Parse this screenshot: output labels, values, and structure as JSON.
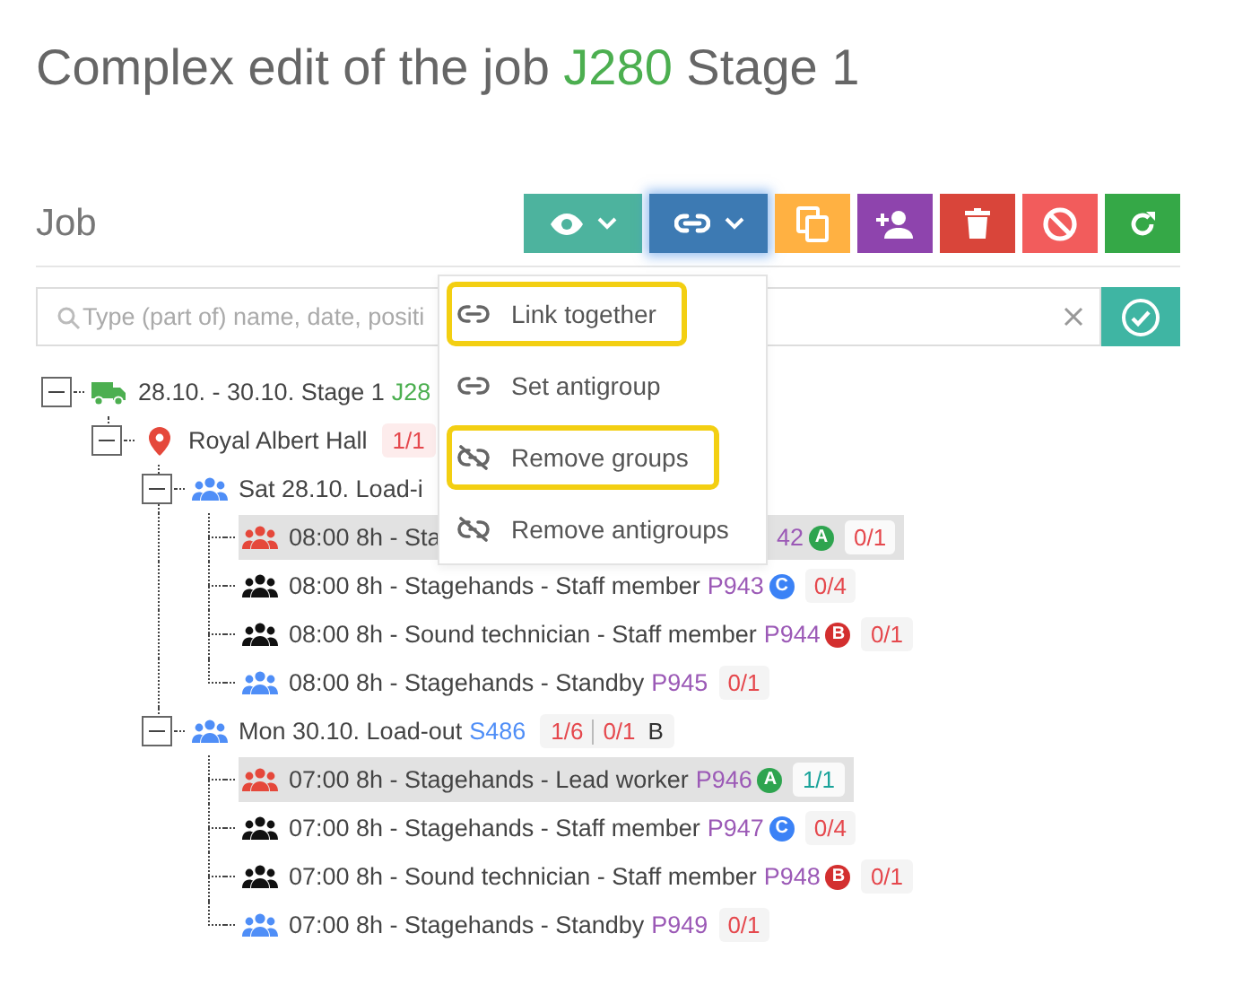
{
  "title": {
    "text": "Complex edit of the job",
    "code": "J280",
    "suffix": "Stage 1"
  },
  "section": {
    "label": "Job"
  },
  "toolbar": [
    {
      "kind": "view",
      "dropdown": true,
      "selected": false
    },
    {
      "kind": "link",
      "dropdown": true,
      "selected": true
    },
    {
      "kind": "copy",
      "dropdown": false,
      "selected": false
    },
    {
      "kind": "add-person",
      "dropdown": false,
      "selected": false
    },
    {
      "kind": "delete",
      "dropdown": false,
      "selected": false
    },
    {
      "kind": "cancel",
      "dropdown": false,
      "selected": false
    },
    {
      "kind": "refresh",
      "dropdown": false,
      "selected": false
    }
  ],
  "search": {
    "placeholder": "Type (part of) name, date, positi"
  },
  "menu": {
    "items": [
      {
        "kind": "link",
        "label": "Link together",
        "highlighted": true
      },
      {
        "kind": "link",
        "label": "Set antigroup",
        "highlighted": false
      },
      {
        "kind": "unlink",
        "label": "Remove groups",
        "highlighted": true
      },
      {
        "kind": "unlink",
        "label": "Remove antigroups",
        "highlighted": false
      }
    ]
  },
  "tree": [
    {
      "kind": "job",
      "expanded": true,
      "text": "28.10. - 30.10. Stage 1",
      "code": "J28",
      "children": [
        {
          "kind": "venue",
          "expanded": true,
          "text": "Royal Albert Hall",
          "counts": [
            {
              "text": "1/1",
              "color": "#e5484d"
            }
          ],
          "children": [
            {
              "kind": "day",
              "expanded": true,
              "text": "Sat 28.10. Load-i",
              "children": [
                {
                  "kind": "shift",
                  "color": "#e5483b",
                  "selected": true,
                  "covered": true,
                  "text": "08:00 8h - Sta",
                  "code": "42",
                  "tag": {
                    "letter": "A",
                    "color": "#2ea44f"
                  },
                  "count": {
                    "text": "0/1",
                    "color": "#e5484d"
                  }
                },
                {
                  "kind": "shift",
                  "color": "#111111",
                  "selected": false,
                  "covered": false,
                  "text": "08:00 8h - Stagehands - Staff member",
                  "code": "P943",
                  "tag": {
                    "letter": "C",
                    "color": "#3b82f6"
                  },
                  "count": {
                    "text": "0/4",
                    "color": "#e5484d"
                  }
                },
                {
                  "kind": "shift",
                  "color": "#111111",
                  "selected": false,
                  "covered": false,
                  "text": "08:00 8h - Sound technician - Staff member",
                  "code": "P944",
                  "tag": {
                    "letter": "B",
                    "color": "#d32f2f"
                  },
                  "count": {
                    "text": "0/1",
                    "color": "#e5484d"
                  }
                },
                {
                  "kind": "shift",
                  "color": "#4f8ef7",
                  "selected": false,
                  "covered": false,
                  "text": "08:00 8h - Stagehands - Standby",
                  "code": "P945",
                  "count": {
                    "text": "0/1",
                    "color": "#e5484d"
                  }
                }
              ]
            },
            {
              "kind": "day",
              "expanded": true,
              "text": "Mon 30.10. Load-out",
              "code": "S486",
              "counts": [
                {
                  "text": "1/6",
                  "color": "#e5484d"
                },
                {
                  "text": "0/1",
                  "color": "#e5484d"
                }
              ],
              "note": "B",
              "children": [
                {
                  "kind": "shift",
                  "color": "#e5483b",
                  "selected": true,
                  "covered": false,
                  "text": "07:00 8h - Stagehands - Lead worker",
                  "code": "P946",
                  "tag": {
                    "letter": "A",
                    "color": "#2ea44f"
                  },
                  "count": {
                    "text": "1/1",
                    "color": "#1aa39a"
                  }
                },
                {
                  "kind": "shift",
                  "color": "#111111",
                  "selected": false,
                  "covered": false,
                  "text": "07:00 8h - Stagehands - Staff member",
                  "code": "P947",
                  "tag": {
                    "letter": "C",
                    "color": "#3b82f6"
                  },
                  "count": {
                    "text": "0/4",
                    "color": "#e5484d"
                  }
                },
                {
                  "kind": "shift",
                  "color": "#111111",
                  "selected": false,
                  "covered": false,
                  "text": "07:00 8h - Sound technician - Staff member",
                  "code": "P948",
                  "tag": {
                    "letter": "B",
                    "color": "#d32f2f"
                  },
                  "count": {
                    "text": "0/1",
                    "color": "#e5484d"
                  }
                },
                {
                  "kind": "shift",
                  "color": "#4f8ef7",
                  "selected": false,
                  "covered": false,
                  "text": "07:00 8h - Stagehands - Standby",
                  "code": "P949",
                  "count": {
                    "text": "0/1",
                    "color": "#e5484d"
                  }
                }
              ]
            }
          ]
        }
      ]
    }
  ]
}
